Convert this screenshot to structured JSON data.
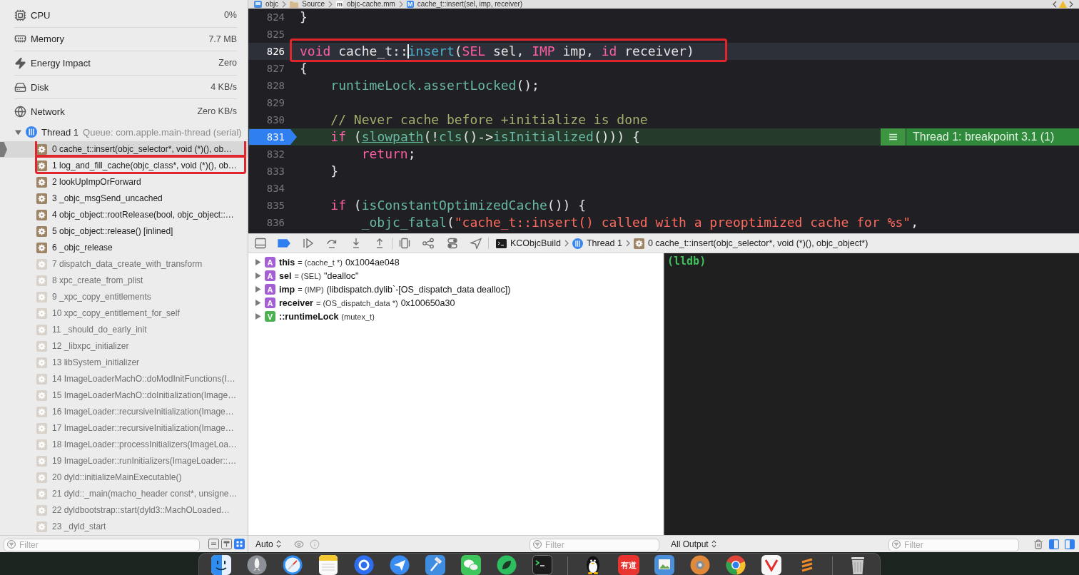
{
  "sidebar": {
    "gauges": [
      {
        "kind": "cpu",
        "label": "CPU",
        "value": "0%"
      },
      {
        "kind": "memory",
        "label": "Memory",
        "value": "7.7 MB"
      },
      {
        "kind": "energy",
        "label": "Energy Impact",
        "value": "Zero"
      },
      {
        "kind": "disk",
        "label": "Disk",
        "value": "4 KB/s"
      },
      {
        "kind": "network",
        "label": "Network",
        "value": "Zero KB/s"
      }
    ],
    "thread": {
      "name": "Thread 1",
      "queue": "Queue: com.apple.main-thread (serial)",
      "expanded": true
    },
    "frames": [
      {
        "label": "0 cache_t::insert(objc_selector*, void (*)(), ob…",
        "selected": true,
        "dimmed": false,
        "highlighted": true
      },
      {
        "label": "1 log_and_fill_cache(objc_class*, void (*)(), ob…",
        "selected": false,
        "dimmed": false,
        "highlighted": true
      },
      {
        "label": "2 lookUpImpOrForward",
        "selected": false,
        "dimmed": false,
        "highlighted": false
      },
      {
        "label": "3 _objc_msgSend_uncached",
        "selected": false,
        "dimmed": false,
        "highlighted": false
      },
      {
        "label": "4 objc_object::rootRelease(bool, objc_object::…",
        "selected": false,
        "dimmed": false,
        "highlighted": false
      },
      {
        "label": "5 objc_object::release() [inlined]",
        "selected": false,
        "dimmed": false,
        "highlighted": false
      },
      {
        "label": "6 _objc_release",
        "selected": false,
        "dimmed": false,
        "highlighted": false
      },
      {
        "label": "7 dispatch_data_create_with_transform",
        "selected": false,
        "dimmed": true,
        "highlighted": false
      },
      {
        "label": "8 xpc_create_from_plist",
        "selected": false,
        "dimmed": true,
        "highlighted": false
      },
      {
        "label": "9 _xpc_copy_entitlements",
        "selected": false,
        "dimmed": true,
        "highlighted": false
      },
      {
        "label": "10 xpc_copy_entitlement_for_self",
        "selected": false,
        "dimmed": true,
        "highlighted": false
      },
      {
        "label": "11 _should_do_early_init",
        "selected": false,
        "dimmed": true,
        "highlighted": false
      },
      {
        "label": "12 _libxpc_initializer",
        "selected": false,
        "dimmed": true,
        "highlighted": false
      },
      {
        "label": "13 libSystem_initializer",
        "selected": false,
        "dimmed": true,
        "highlighted": false
      },
      {
        "label": "14 ImageLoaderMachO::doModInitFunctions(I…",
        "selected": false,
        "dimmed": true,
        "highlighted": false
      },
      {
        "label": "15 ImageLoaderMachO::doInitialization(Image…",
        "selected": false,
        "dimmed": true,
        "highlighted": false
      },
      {
        "label": "16 ImageLoader::recursiveInitialization(Image…",
        "selected": false,
        "dimmed": true,
        "highlighted": false
      },
      {
        "label": "17 ImageLoader::recursiveInitialization(Image…",
        "selected": false,
        "dimmed": true,
        "highlighted": false
      },
      {
        "label": "18 ImageLoader::processInitializers(ImageLoa…",
        "selected": false,
        "dimmed": true,
        "highlighted": false
      },
      {
        "label": "19 ImageLoader::runInitializers(ImageLoader::…",
        "selected": false,
        "dimmed": true,
        "highlighted": false
      },
      {
        "label": "20 dyld::initializeMainExecutable()",
        "selected": false,
        "dimmed": true,
        "highlighted": false
      },
      {
        "label": "21 dyld::_main(macho_header const*, unsigne…",
        "selected": false,
        "dimmed": true,
        "highlighted": false
      },
      {
        "label": "22 dyldbootstrap::start(dyld3::MachOLoaded…",
        "selected": false,
        "dimmed": true,
        "highlighted": false
      },
      {
        "label": "23 _dyld_start",
        "selected": false,
        "dimmed": true,
        "highlighted": false
      }
    ],
    "filter": {
      "placeholder": "Filter"
    },
    "filter_buttons": [
      {
        "kind": "process",
        "selected": false
      },
      {
        "kind": "thread",
        "selected": false
      },
      {
        "kind": "frames",
        "selected": true
      }
    ]
  },
  "editor": {
    "breadcrumb": [
      {
        "kind": "project",
        "label": "objc"
      },
      {
        "kind": "folder",
        "label": "Source"
      },
      {
        "kind": "file",
        "badge": "m",
        "label": "objc-cache.mm"
      },
      {
        "kind": "method",
        "badge": "M",
        "label": "cache_t::insert(sel, imp, receiver)"
      }
    ],
    "lines": [
      {
        "number": "824",
        "tokens": [
          {
            "kind": "plain",
            "text": "}"
          }
        ],
        "current": false,
        "breakpoint": false,
        "paused": false,
        "highlighted": false,
        "caret": false
      },
      {
        "number": "825",
        "current": false,
        "breakpoint": false,
        "paused": false,
        "highlighted": false,
        "caret": false
      },
      {
        "number": "826",
        "tokens": [
          {
            "kind": "keyword",
            "text": "void"
          },
          {
            "kind": "plain",
            "text": " cache_t::"
          },
          {
            "kind": "declaration",
            "text": "insert"
          },
          {
            "kind": "plain",
            "text": "("
          },
          {
            "kind": "keyword",
            "text": "SEL"
          },
          {
            "kind": "plain",
            "text": " sel, "
          },
          {
            "kind": "keyword",
            "text": "IMP"
          },
          {
            "kind": "plain",
            "text": " imp, "
          },
          {
            "kind": "keyword",
            "text": "id"
          },
          {
            "kind": "plain",
            "text": " receiver)"
          }
        ],
        "current": true,
        "breakpoint": false,
        "paused": false,
        "highlighted": true,
        "caret": true
      },
      {
        "number": "827",
        "tokens": [
          {
            "kind": "plain",
            "text": "{"
          }
        ],
        "current": false,
        "breakpoint": false,
        "paused": false,
        "highlighted": false,
        "caret": false
      },
      {
        "number": "828",
        "tokens": [
          {
            "kind": "function",
            "text": "    runtimeLock.assertLocked"
          },
          {
            "kind": "plain",
            "text": "();"
          }
        ],
        "current": false,
        "breakpoint": false,
        "paused": false,
        "highlighted": false,
        "caret": false
      },
      {
        "number": "829",
        "current": false,
        "breakpoint": false,
        "paused": false,
        "highlighted": false,
        "caret": false
      },
      {
        "number": "830",
        "tokens": [
          {
            "kind": "comment",
            "text": "    // Never cache before +initialize is done"
          }
        ],
        "current": false,
        "breakpoint": false,
        "paused": false,
        "highlighted": false,
        "caret": false
      },
      {
        "number": "831",
        "tokens": [
          {
            "kind": "keyword",
            "text": "    if"
          },
          {
            "kind": "plain",
            "text": " ("
          },
          {
            "kind": "link",
            "text": "slowpath"
          },
          {
            "kind": "plain",
            "text": "(!"
          },
          {
            "kind": "function",
            "text": "cls"
          },
          {
            "kind": "plain",
            "text": "()->"
          },
          {
            "kind": "function",
            "text": "isInitialized"
          },
          {
            "kind": "plain",
            "text": "())) {"
          }
        ],
        "current": false,
        "breakpoint": true,
        "paused": true,
        "highlighted": false,
        "caret": false,
        "annotation": "Thread 1: breakpoint 3.1 (1)"
      },
      {
        "number": "832",
        "tokens": [
          {
            "kind": "keyword",
            "text": "        return"
          },
          {
            "kind": "plain",
            "text": ";"
          }
        ],
        "current": false,
        "breakpoint": false,
        "paused": false,
        "highlighted": false,
        "caret": false
      },
      {
        "number": "833",
        "tokens": [
          {
            "kind": "plain",
            "text": "    }"
          }
        ],
        "current": false,
        "breakpoint": false,
        "paused": false,
        "highlighted": false,
        "caret": false
      },
      {
        "number": "834",
        "current": false,
        "breakpoint": false,
        "paused": false,
        "highlighted": false,
        "caret": false
      },
      {
        "number": "835",
        "tokens": [
          {
            "kind": "keyword",
            "text": "    if"
          },
          {
            "kind": "plain",
            "text": " ("
          },
          {
            "kind": "function",
            "text": "isConstantOptimizedCache"
          },
          {
            "kind": "plain",
            "text": "()) {"
          }
        ],
        "current": false,
        "breakpoint": false,
        "paused": false,
        "highlighted": false,
        "caret": false
      },
      {
        "number": "836",
        "tokens": [
          {
            "kind": "function",
            "text": "        _objc_fatal"
          },
          {
            "kind": "plain",
            "text": "("
          },
          {
            "kind": "string",
            "text": "\"cache_t::insert() called with a preoptimized cache for %s\""
          },
          {
            "kind": "plain",
            "text": ","
          }
        ],
        "current": false,
        "breakpoint": false,
        "paused": false,
        "highlighted": false,
        "caret": false
      }
    ]
  },
  "debug_bar": {
    "breakpoints_active": true,
    "button_groups": [
      [
        {
          "kind": "panel"
        },
        {
          "kind": "breakpoints"
        },
        {
          "kind": "continue"
        },
        {
          "kind": "step-over"
        },
        {
          "kind": "step-into"
        },
        {
          "kind": "step-out"
        }
      ],
      [
        {
          "kind": "view-debugger"
        },
        {
          "kind": "memory-graph"
        },
        {
          "kind": "environment"
        },
        {
          "kind": "location"
        }
      ]
    ],
    "path": [
      {
        "kind": "process",
        "label": "KCObjcBuild"
      },
      {
        "kind": "thread",
        "label": "Thread 1"
      },
      {
        "kind": "frame",
        "label": "0 cache_t::insert(objc_selector*, void (*)(), objc_object*)"
      }
    ]
  },
  "variables": [
    {
      "badge": "A",
      "color": "#a55fd5",
      "name": "this",
      "type": "= (cache_t *)",
      "value": "0x1004ae048",
      "expanded": false
    },
    {
      "badge": "A",
      "color": "#a55fd5",
      "name": "sel",
      "type": "= (SEL)",
      "value": "\"dealloc\"",
      "expanded": false
    },
    {
      "badge": "A",
      "color": "#a55fd5",
      "name": "imp",
      "type": "= (IMP)",
      "value": "(libdispatch.dylib`-[OS_dispatch_data dealloc])",
      "expanded": false
    },
    {
      "badge": "A",
      "color": "#a55fd5",
      "name": "receiver",
      "type": "= (OS_dispatch_data *)",
      "value": "0x100650a30",
      "expanded": false
    },
    {
      "badge": "V",
      "color": "#4cb050",
      "name": "::runtimeLock",
      "type": "(mutex_t)",
      "expanded": false
    }
  ],
  "console": {
    "prompt": "(lldb)"
  },
  "variables_footer": {
    "scope": "Auto",
    "filter_placeholder": "Filter"
  },
  "console_footer": {
    "output": "All Output",
    "filter_placeholder": "Filter",
    "panes": [
      {
        "kind": "variables",
        "selected": true
      },
      {
        "kind": "console",
        "selected": true
      }
    ]
  },
  "dock": {
    "apps": [
      {
        "kind": "face"
      },
      {
        "kind": "rocket"
      },
      {
        "kind": "compass"
      },
      {
        "kind": "notepad"
      },
      {
        "kind": "ring"
      },
      {
        "kind": "plane"
      },
      {
        "kind": "hammer"
      },
      {
        "kind": "chat"
      },
      {
        "kind": "leaf"
      },
      {
        "kind": "terminal"
      },
      {
        "kind": "divider"
      },
      {
        "kind": "penguin"
      },
      {
        "kind": "text-tile",
        "label": "有道"
      },
      {
        "kind": "picture"
      },
      {
        "kind": "circle-logo"
      },
      {
        "kind": "wheel"
      },
      {
        "kind": "check-tile"
      },
      {
        "kind": "stripes"
      },
      {
        "kind": "divider"
      },
      {
        "kind": "trash"
      }
    ]
  }
}
